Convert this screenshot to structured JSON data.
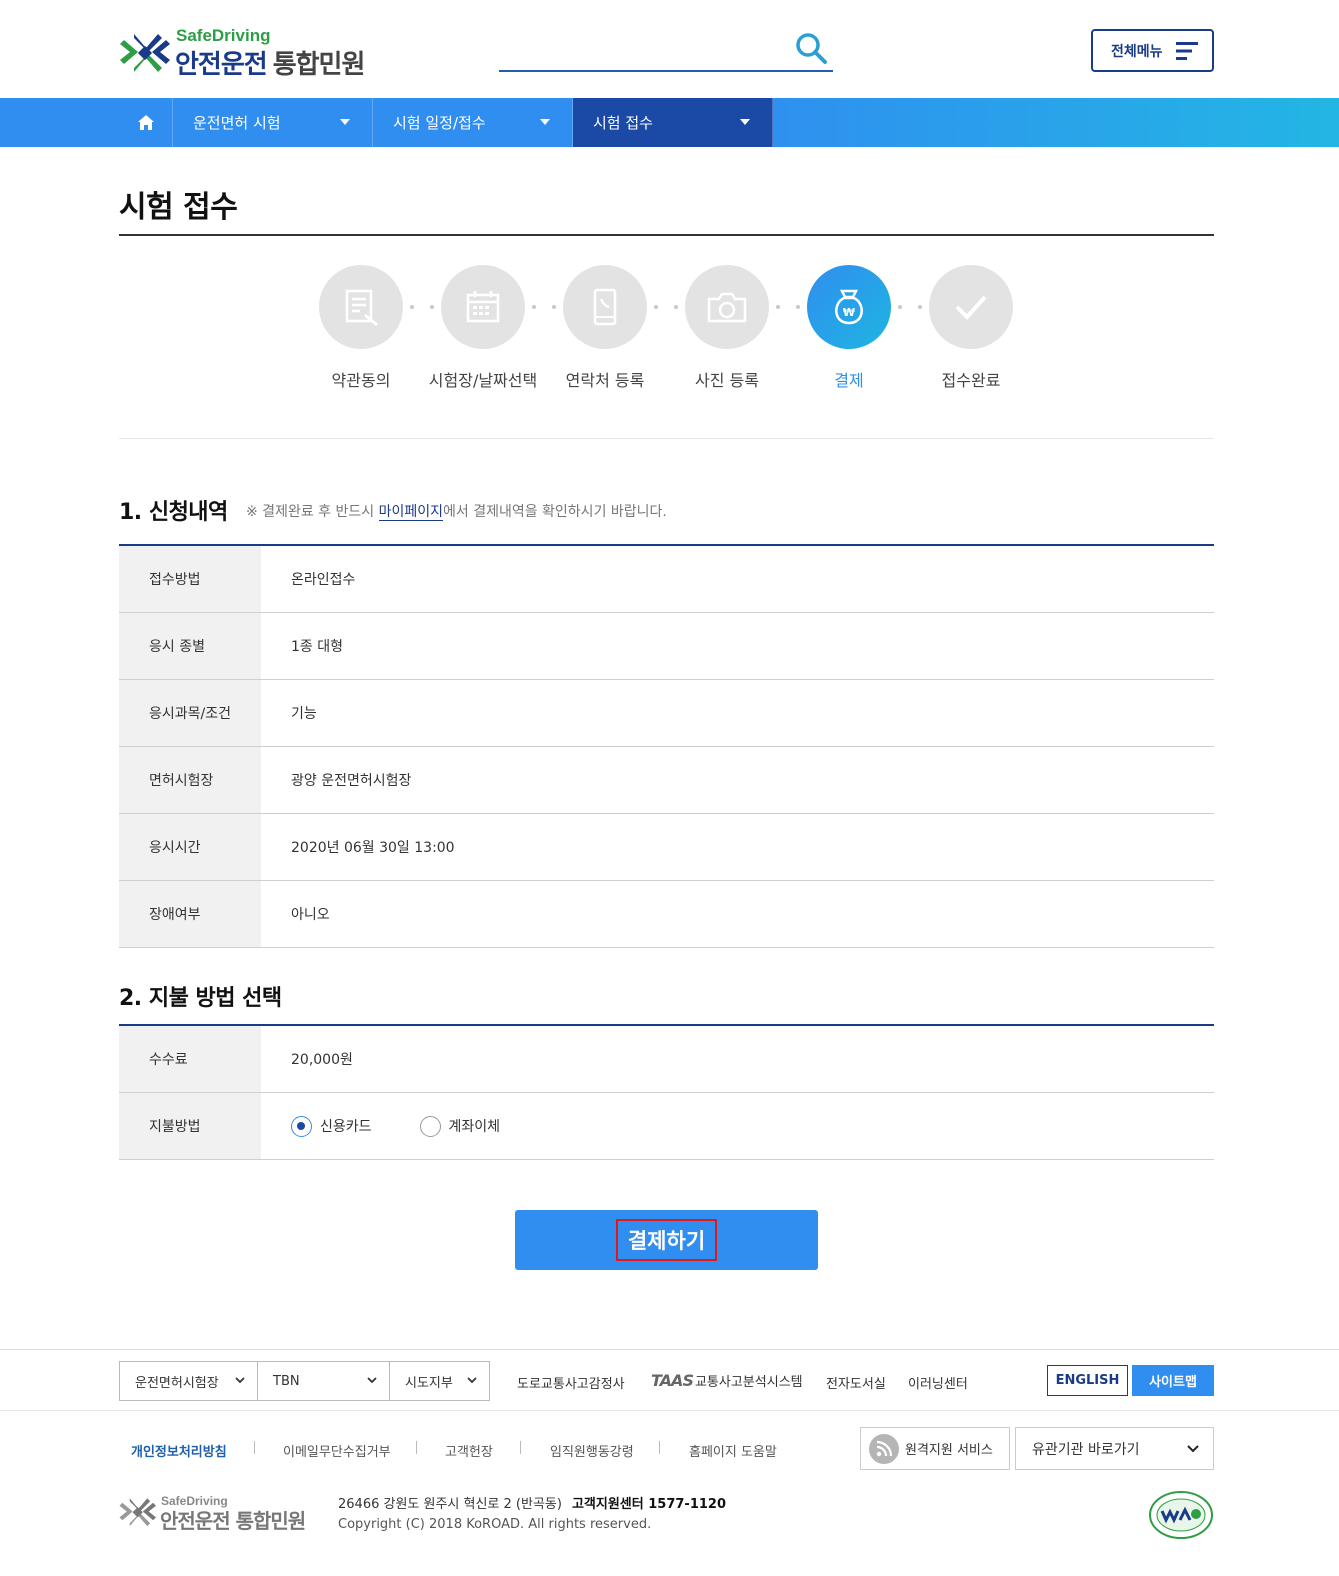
{
  "header": {
    "logo_sub": "SafeDriving",
    "logo_main": "안전운전",
    "logo_main_light": "통합민원",
    "search_placeholder": "",
    "menu_label": "전체메뉴"
  },
  "nav": {
    "items": [
      {
        "label": "운전면허 시험"
      },
      {
        "label": "시험 일정/접수"
      },
      {
        "label": "시험 접수"
      }
    ]
  },
  "page": {
    "title": "시험 접수"
  },
  "steps": [
    {
      "label": "약관동의",
      "icon": "document-pen-icon"
    },
    {
      "label": "시험장/날짜선택",
      "icon": "calendar-icon"
    },
    {
      "label": "연락처 등록",
      "icon": "phone-icon"
    },
    {
      "label": "사진 등록",
      "icon": "camera-icon"
    },
    {
      "label": "결제",
      "icon": "money-bag-icon",
      "active": true
    },
    {
      "label": "접수완료",
      "icon": "check-icon"
    }
  ],
  "section1": {
    "title": "1. 신청내역",
    "note_prefix": "※ 결제완료 후 반드시 ",
    "note_link": "마이페이지",
    "note_suffix": "에서 결제내역을 확인하시기 바랍니다.",
    "rows": [
      {
        "label": "접수방법",
        "value": "온라인접수"
      },
      {
        "label": "응시 종별",
        "value": "1종 대형"
      },
      {
        "label": "응시과목/조건",
        "value": "기능"
      },
      {
        "label": "면허시험장",
        "value": "광양 운전면허시험장"
      },
      {
        "label": "응시시간",
        "value": "2020년 06월 30일 13:00"
      },
      {
        "label": "장애여부",
        "value": "아니오"
      }
    ]
  },
  "section2": {
    "title": "2. 지불 방법 선택",
    "fee_label": "수수료",
    "fee_value": "20,000원",
    "method_label": "지불방법",
    "methods": [
      {
        "label": "신용카드",
        "checked": true
      },
      {
        "label": "계좌이체",
        "checked": false
      }
    ]
  },
  "pay_button": "결제하기",
  "footer": {
    "selects": [
      "운전면허시험장",
      "TBN",
      "시도지부"
    ],
    "links": [
      "도로교통사고감정사",
      "교통사고분석시스템",
      "전자도서실",
      "이러닝센터"
    ],
    "taas": "TAAS",
    "english": "ENGLISH",
    "sitemap": "사이트맵",
    "policy_links": [
      "개인정보처리방침",
      "이메일무단수집거부",
      "고객헌장",
      "임직원행동강령",
      "홈페이지 도움말"
    ],
    "remote": "원격지원 서비스",
    "related": "유관기관 바로가기",
    "logo_sub": "SafeDriving",
    "logo_main": "안전운전 통합민원",
    "address": "26466 강원도 원주시 혁신로 2 (반곡동)",
    "call_center": "고객지원센터 1577-1120",
    "copyright": "Copyright (C) 2018 KoROAD. All rights reserved."
  }
}
